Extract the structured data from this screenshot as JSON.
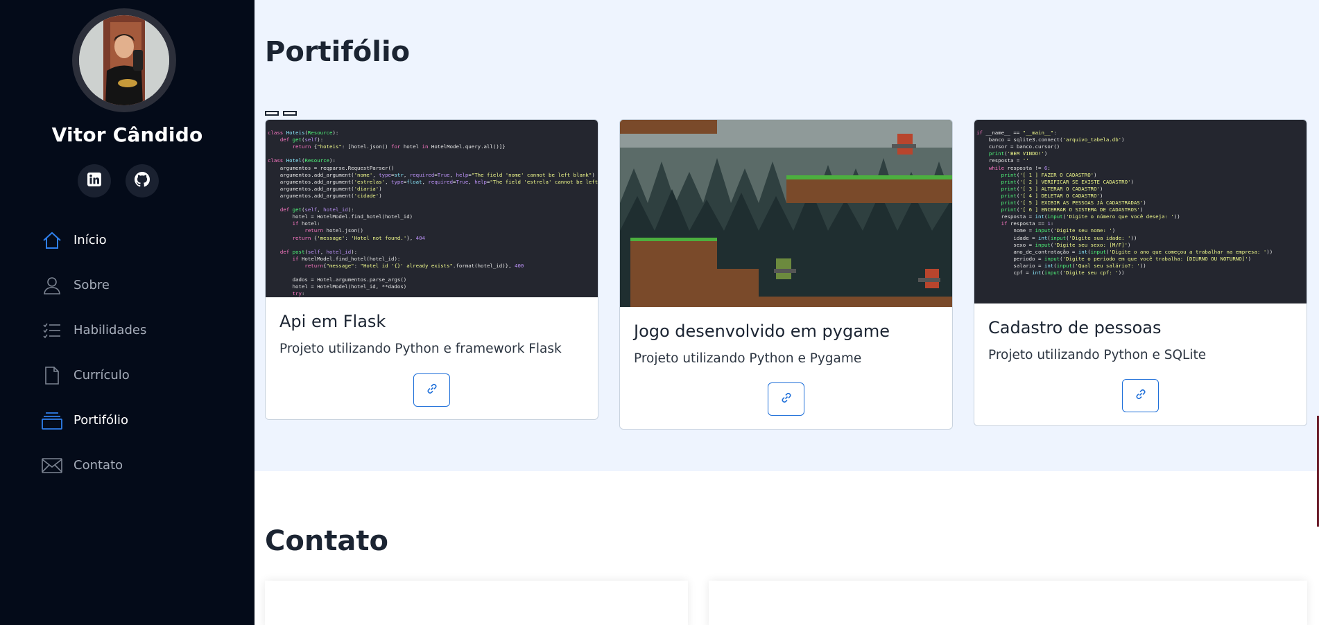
{
  "profile": {
    "name": "Vitor Cândido",
    "avatar_alt": "Foto de perfil"
  },
  "social": {
    "linkedin_icon": "linkedin-icon",
    "github_icon": "github-icon"
  },
  "nav": {
    "items": [
      {
        "label": "Início",
        "icon": "home-icon",
        "active": true
      },
      {
        "label": "Sobre",
        "icon": "person-icon",
        "active": false
      },
      {
        "label": "Habilidades",
        "icon": "list-icon",
        "active": false
      },
      {
        "label": "Currículo",
        "icon": "file-icon",
        "active": false
      },
      {
        "label": "Portifólio",
        "icon": "collection-icon",
        "active": true
      },
      {
        "label": "Contato",
        "icon": "envelope-icon",
        "active": false
      }
    ]
  },
  "portfolio": {
    "title": "Portifólio",
    "projects": [
      {
        "title": "Api em Flask",
        "description": "Projeto utilizando Python e framework Flask",
        "link_icon": "link-icon"
      },
      {
        "title": "Jogo desenvolvido em pygame",
        "description": "Projeto utilizando Python e Pygame",
        "link_icon": "link-icon"
      },
      {
        "title": "Cadastro de pessoas",
        "description": "Projeto utilizando Python e SQLite",
        "link_icon": "link-icon"
      }
    ]
  },
  "contact": {
    "title": "Contato"
  },
  "colors": {
    "sidebar_bg": "#040b19",
    "accent": "#1e6fd9",
    "portfolio_bg": "#eef4fe"
  }
}
